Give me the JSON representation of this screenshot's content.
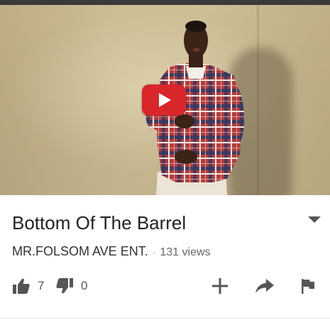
{
  "video": {
    "title": "Bottom Of The Barrel",
    "channel": "MR.FOLSOM AVE ENT.",
    "separator": "·",
    "views": "131 views"
  },
  "actions": {
    "likes": "7",
    "dislikes": "0"
  },
  "colors": {
    "play_button": "#d9262a",
    "icon": "#555555",
    "text": "#222222"
  },
  "icons": [
    "play-icon",
    "expand-chevron-icon",
    "thumbs-up-icon",
    "thumbs-down-icon",
    "add-icon",
    "share-icon",
    "flag-icon"
  ]
}
